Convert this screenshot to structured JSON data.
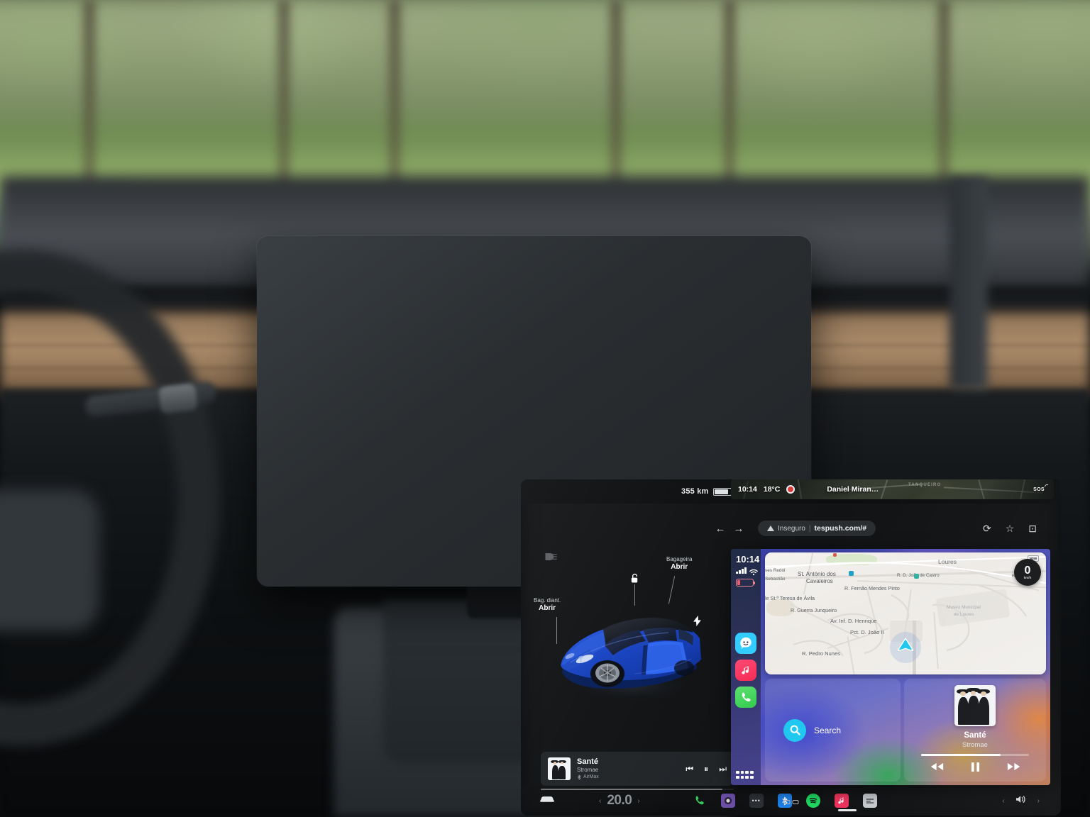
{
  "scene": {
    "description": "Tesla center touchscreen running a browser with Apple CarPlay (tespush.com)"
  },
  "tesla": {
    "status": {
      "range": "355 km",
      "time": "10:14",
      "temp": "18°C",
      "driver": "Daniel Miran…",
      "sos": "SOS"
    },
    "browser": {
      "back_icon": "←",
      "forward_icon": "→",
      "security_label": "Inseguro",
      "separator": "|",
      "url": "tespush.com/#",
      "reload_icon": "⟳",
      "bookmark_icon": "☆",
      "cast_icon": "⊡"
    },
    "car_view": {
      "headlight_icon": "headlight",
      "lock_icon": "unlocked",
      "charge_icon": "bolt",
      "front_trunk": {
        "label": "Bag. diant.",
        "action": "Abrir"
      },
      "rear_trunk": {
        "label": "Bagageira",
        "action": "Abrir"
      }
    },
    "media": {
      "title": "Santé",
      "artist": "Stromae",
      "device": "AirMax",
      "prev_icon": "⏮",
      "pause_icon": "⏸",
      "next_icon": "⏭"
    },
    "taskbar": {
      "car_icon": "car",
      "temp": "20.0",
      "left_chevron": "‹",
      "right_chevron": "›",
      "apps": [
        {
          "name": "phone",
          "glyph": "📞",
          "color": "#35c759"
        },
        {
          "name": "dashcam",
          "glyph": "◉",
          "color": "#6b4fa8"
        },
        {
          "name": "more",
          "glyph": "•••",
          "color": "#2b2f33"
        },
        {
          "name": "bluetooth",
          "glyph": "ᛒ",
          "color": "#1d7fe8"
        },
        {
          "name": "spotify",
          "glyph": "♪",
          "color": "#1ed760"
        },
        {
          "name": "apple-music",
          "glyph": "♫",
          "color": "#f0325c"
        },
        {
          "name": "carplay-radio",
          "glyph": "▤",
          "color": "#c9cdd1"
        }
      ],
      "volume_icon": "🔊"
    }
  },
  "carplay": {
    "statusbar": {
      "time": "10:14",
      "signal": "signal-bars",
      "wifi": "wifi-icon",
      "battery": "battery-low"
    },
    "dock": [
      {
        "name": "waze",
        "color": "#33ccff"
      },
      {
        "name": "apple-music",
        "color": "#fa2d55"
      },
      {
        "name": "phone",
        "color": "#4cd964"
      }
    ],
    "app_grid_icon": "app-grid",
    "map": {
      "speed": "0",
      "speed_unit": "km/h",
      "speed_limit": "N250",
      "labels": [
        "Loures",
        "St. António dos",
        "Cavaleiros",
        "R. D. João de Castro",
        "R. Vieira",
        "R. Fernão Mendes Pinto",
        "le St.ª Teresa de Ávila",
        "R. Guerra Junqueiro",
        "Av. Inf. D. Henrique",
        "Pct. D. João II",
        "R. Pedro Nunes",
        "Museu Municipal",
        "de Loures",
        "ves Redol",
        "Sebastião"
      ]
    },
    "search": {
      "label": "Search",
      "icon": "search-icon"
    },
    "now_playing": {
      "title": "Santé",
      "artist": "Stromae",
      "rewind_icon": "⏪",
      "pause_icon": "⏸",
      "forward_icon": "⏩",
      "progress_percent": 74
    }
  }
}
